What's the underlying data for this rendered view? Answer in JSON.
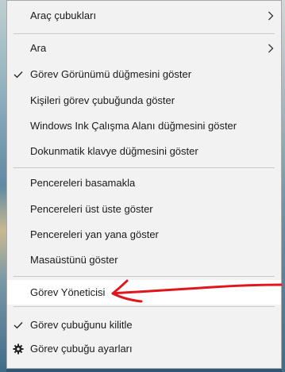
{
  "menu": {
    "items": [
      {
        "label": "Araç çubukları",
        "checked": false,
        "submenu": true,
        "icon": "",
        "hover": false
      },
      {
        "label": "Ara",
        "checked": false,
        "submenu": true,
        "icon": "",
        "hover": false
      },
      {
        "label": "Görev Görünümü düğmesini göster",
        "checked": true,
        "submenu": false,
        "icon": "checkmark-icon",
        "hover": false
      },
      {
        "label": "Kişileri görev çubuğunda göster",
        "checked": false,
        "submenu": false,
        "icon": "",
        "hover": false
      },
      {
        "label": "Windows Ink Çalışma Alanı düğmesini göster",
        "checked": false,
        "submenu": false,
        "icon": "",
        "hover": false
      },
      {
        "label": "Dokunmatik klavye düğmesini göster",
        "checked": false,
        "submenu": false,
        "icon": "",
        "hover": false
      },
      {
        "label": "Pencereleri basamakla",
        "checked": false,
        "submenu": false,
        "icon": "",
        "hover": false
      },
      {
        "label": "Pencereleri üst üste göster",
        "checked": false,
        "submenu": false,
        "icon": "",
        "hover": false
      },
      {
        "label": "Pencereleri yan yana göster",
        "checked": false,
        "submenu": false,
        "icon": "",
        "hover": false
      },
      {
        "label": "Masaüstünü göster",
        "checked": false,
        "submenu": false,
        "icon": "",
        "hover": false
      },
      {
        "label": "Görev Yöneticisi",
        "checked": false,
        "submenu": false,
        "icon": "",
        "hover": true
      },
      {
        "label": "Görev çubuğunu kilitle",
        "checked": true,
        "submenu": false,
        "icon": "checkmark-icon",
        "hover": false
      },
      {
        "label": "Görev çubuğu ayarları",
        "checked": false,
        "submenu": false,
        "icon": "gear-icon",
        "hover": false
      }
    ]
  },
  "annotation": {
    "color": "#e0161c",
    "shape": "hand-drawn-arrow"
  },
  "colors": {
    "menu_background": "#f2f2f2",
    "hover_background": "#ffffff",
    "separator": "#c8c8c8",
    "text": "#1a1a1a"
  }
}
